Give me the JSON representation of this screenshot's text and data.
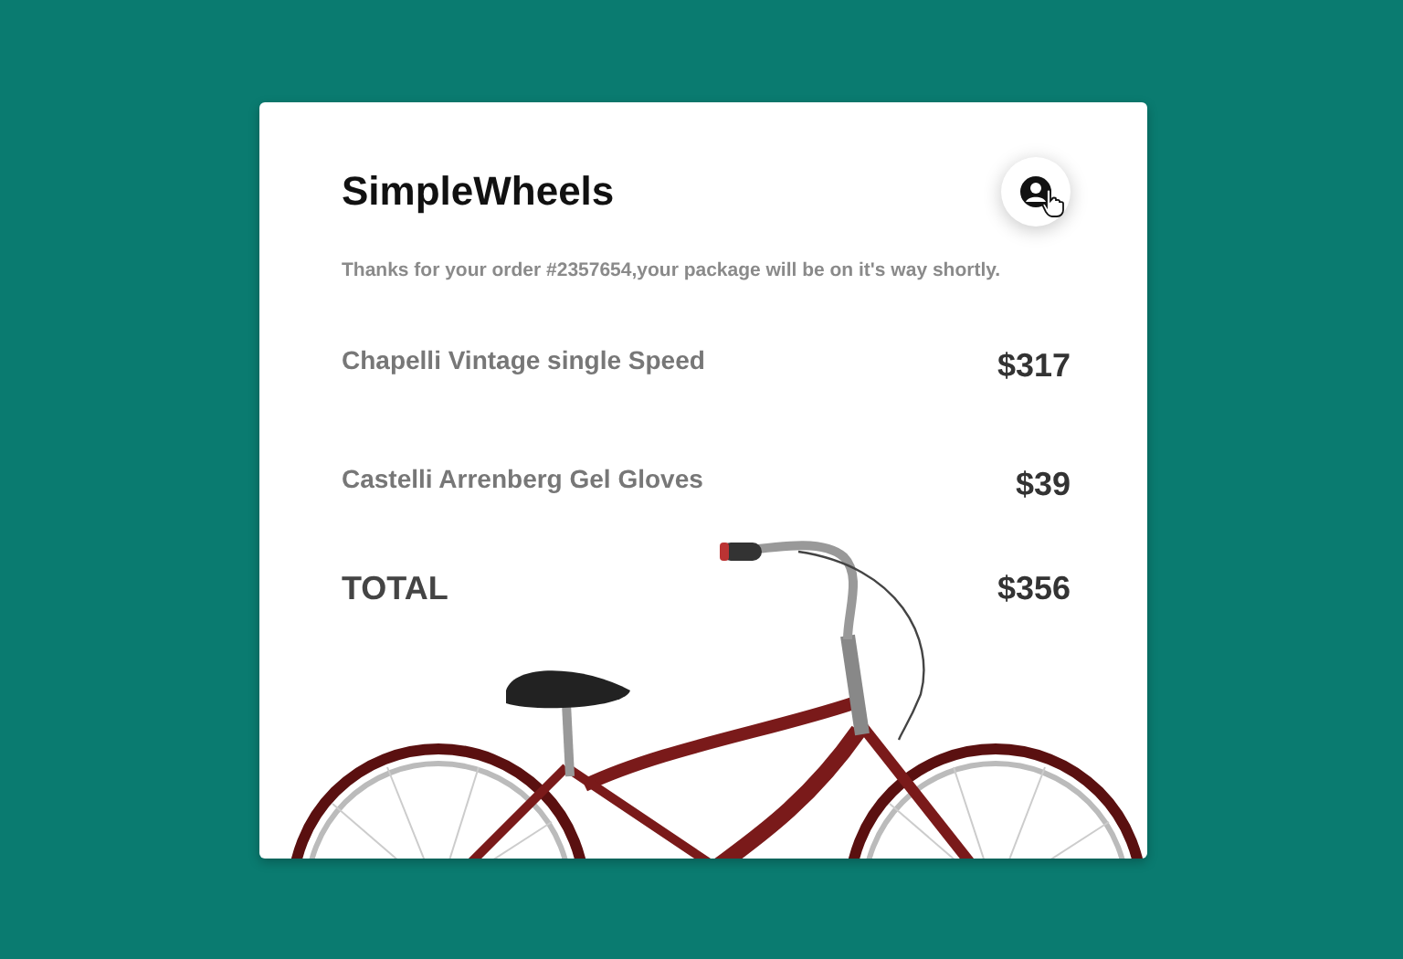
{
  "brand": "SimpleWheels",
  "message": "Thanks for your order #2357654,your package will be on it's way shortly.",
  "items": [
    {
      "name": "Chapelli Vintage single Speed",
      "price": "$317"
    },
    {
      "name": "Castelli Arrenberg Gel Gloves",
      "price": "$39"
    }
  ],
  "total": {
    "label": "TOTAL",
    "amount": "$356"
  }
}
